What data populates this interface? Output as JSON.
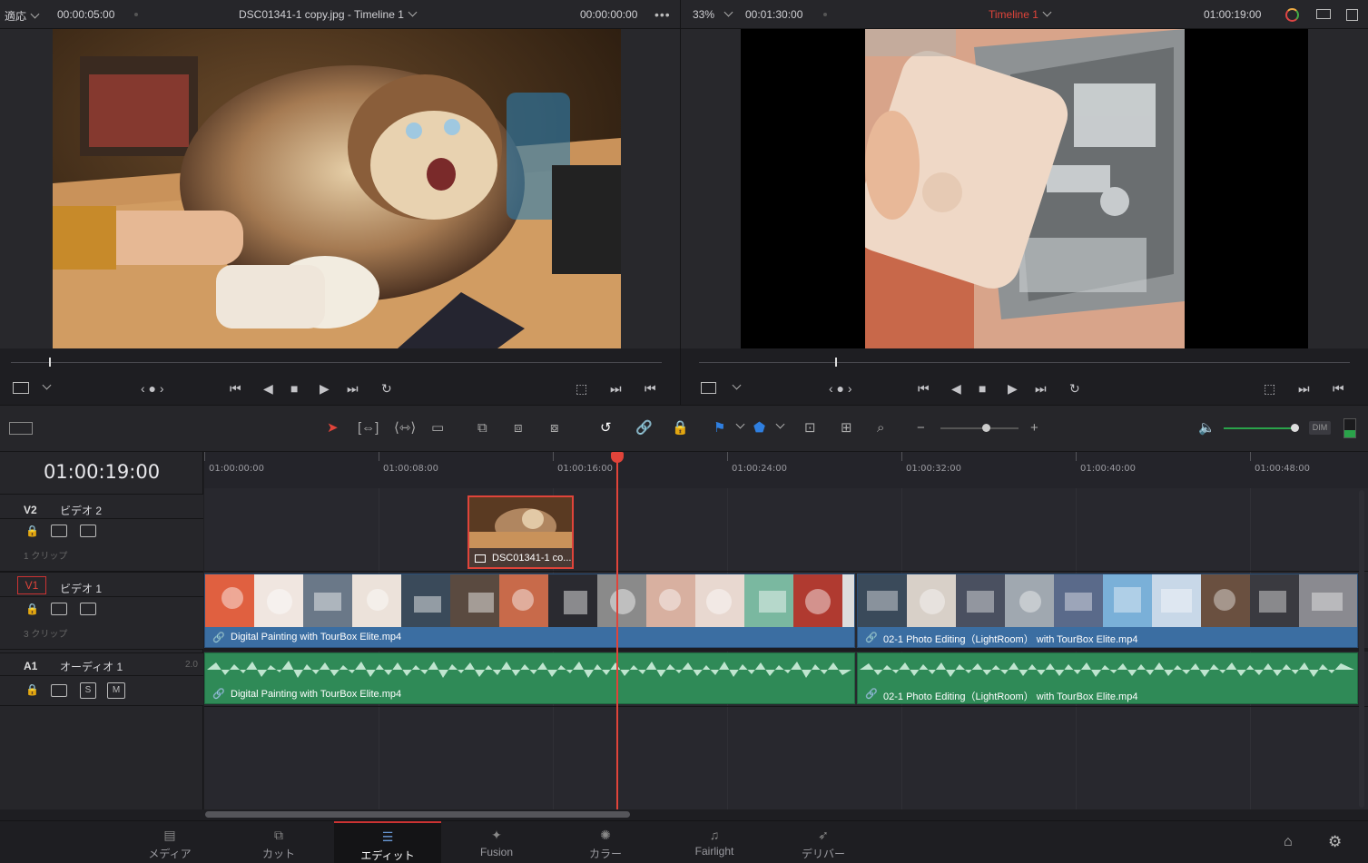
{
  "source_viewer": {
    "zoom": "適応",
    "timecode_duration": "00:00:05:00",
    "clip_title": "DSC01341-1 copy.jpg - Timeline 1",
    "timecode_current": "00:00:00:00"
  },
  "timeline_viewer": {
    "zoom": "33%",
    "timecode_duration": "00:01:30:00",
    "timeline_name": "Timeline 1",
    "timecode_current": "01:00:19:00"
  },
  "timeline": {
    "timecode": "01:00:19:00",
    "ruler_ticks": [
      "01:00:00:00",
      "01:00:08:00",
      "01:00:16:00",
      "01:00:24:00",
      "01:00:32:00",
      "01:00:40:00",
      "01:00:48:00"
    ],
    "tracks": [
      {
        "id": "V2",
        "name": "ビデオ 2",
        "clip_count": "1 クリップ"
      },
      {
        "id": "V1",
        "name": "ビデオ 1",
        "clip_count": "3 クリップ"
      },
      {
        "id": "A1",
        "name": "オーディオ 1",
        "channels": "2.0",
        "solo": "S",
        "mute": "M"
      }
    ],
    "clips": {
      "v2_clip": "DSC01341-1 co...",
      "v1_clip_1": "Digital Painting with TourBox Elite.mp4",
      "v1_clip_2": "02-1 Photo Editing（LightRoom） with TourBox Elite.mp4",
      "a1_clip_1": "Digital Painting with TourBox Elite.mp4",
      "a1_clip_2": "02-1 Photo Editing（LightRoom） with TourBox Elite.mp4"
    },
    "dim_label": "DIM",
    "volume_level": 0.95
  },
  "pages": [
    {
      "label": "メディア",
      "icon": "media-icon"
    },
    {
      "label": "カット",
      "icon": "cut-icon"
    },
    {
      "label": "エディット",
      "icon": "edit-icon",
      "active": true
    },
    {
      "label": "Fusion",
      "icon": "fusion-icon"
    },
    {
      "label": "カラー",
      "icon": "color-icon"
    },
    {
      "label": "Fairlight",
      "icon": "fairlight-icon"
    },
    {
      "label": "デリバー",
      "icon": "deliver-icon"
    }
  ],
  "colors": {
    "playhead": "#e0443a",
    "video_clip": "#3b6ea2",
    "audio_clip": "#2f8a57",
    "timeline_name": "#e0443a"
  }
}
